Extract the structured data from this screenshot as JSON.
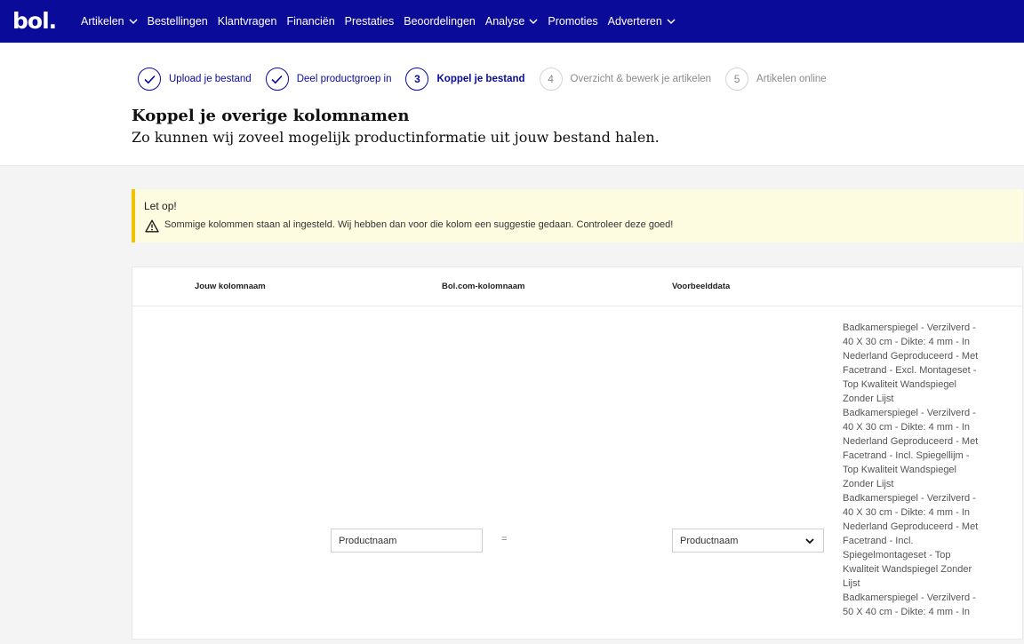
{
  "nav": {
    "logo": "bol.",
    "items": [
      {
        "label": "Artikelen",
        "has_dropdown": true
      },
      {
        "label": "Bestellingen",
        "has_dropdown": false
      },
      {
        "label": "Klantvragen",
        "has_dropdown": false
      },
      {
        "label": "Financiën",
        "has_dropdown": false
      },
      {
        "label": "Prestaties",
        "has_dropdown": false
      },
      {
        "label": "Beoordelingen",
        "has_dropdown": false
      },
      {
        "label": "Analyse",
        "has_dropdown": true
      },
      {
        "label": "Promoties",
        "has_dropdown": false
      },
      {
        "label": "Adverteren",
        "has_dropdown": true
      }
    ]
  },
  "stepper": {
    "steps": [
      {
        "number": "",
        "label": "Upload je bestand",
        "state": "done"
      },
      {
        "number": "",
        "label": "Deel productgroep in",
        "state": "done"
      },
      {
        "number": "3",
        "label": "Koppel je bestand",
        "state": "active"
      },
      {
        "number": "4",
        "label": "Overzicht & bewerk je artikelen",
        "state": "future"
      },
      {
        "number": "5",
        "label": "Artikelen online",
        "state": "future"
      }
    ]
  },
  "page": {
    "title": "Koppel je overige kolomnamen",
    "subtitle": "Zo kunnen wij zoveel mogelijk productinformatie uit jouw bestand halen."
  },
  "alert": {
    "title": "Let op!",
    "text": "Sommige kolommen staan al ingesteld. Wij hebben dan voor die kolom een suggestie gedaan. Controleer deze goed!"
  },
  "table": {
    "headers": {
      "your_column": "Jouw kolomnaam",
      "bol_column": "Bol.com-kolomnaam",
      "example": "Voorbeelddata"
    },
    "row": {
      "your_column_value": "Productnaam",
      "equals": "=",
      "bol_column_selected": "Productnaam",
      "example_lines": [
        "Badkamerspiegel - Verzilverd -",
        "40 X 30 cm - Dikte: 4 mm - In",
        "Nederland Geproduceerd - Met",
        "Facetrand - Excl. Montageset -",
        "Top Kwaliteit Wandspiegel",
        "Zonder Lijst",
        "Badkamerspiegel - Verzilverd -",
        "40 X 30 cm - Dikte: 4 mm - In",
        "Nederland Geproduceerd - Met",
        "Facetrand - Incl. Spiegellijm -",
        "Top Kwaliteit Wandspiegel",
        "Zonder Lijst",
        "Badkamerspiegel - Verzilverd -",
        "40 X 30 cm - Dikte: 4 mm - In",
        "Nederland Geproduceerd - Met",
        "Facetrand - Incl.",
        "Spiegelmontageset - Top",
        "Kwaliteit Wandspiegel Zonder",
        "Lijst",
        "Badkamerspiegel - Verzilverd -",
        "50 X 40 cm - Dikte: 4 mm - In"
      ]
    }
  }
}
